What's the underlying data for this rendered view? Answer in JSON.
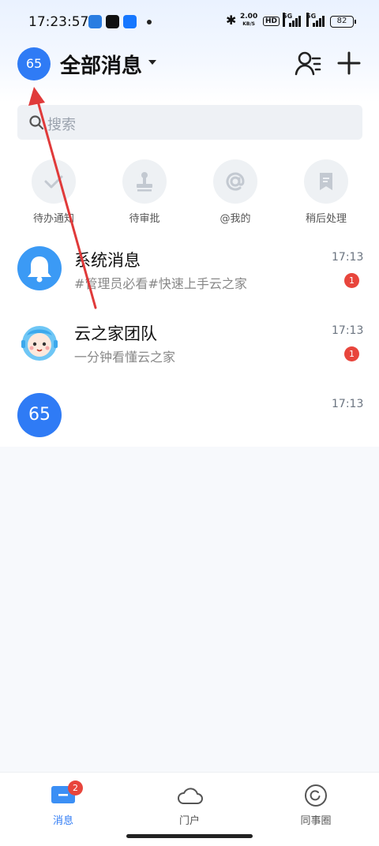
{
  "status_bar": {
    "time": "17:23:57",
    "net_speed_value": "2.00",
    "net_speed_unit": "KB/S",
    "hd_label": "HD",
    "signal_1_label": "5G",
    "signal_2_label": "5G",
    "battery": "82"
  },
  "header": {
    "avatar_text": "65",
    "title": "全部消息"
  },
  "search": {
    "placeholder": "搜索"
  },
  "quick_actions": [
    {
      "label": "待办通知",
      "icon": "check-icon"
    },
    {
      "label": "待审批",
      "icon": "stamp-icon"
    },
    {
      "label": "@我的",
      "icon": "at-icon"
    },
    {
      "label": "稍后处理",
      "icon": "bookmark-icon"
    }
  ],
  "conversations": [
    {
      "name": "系统消息",
      "preview": "#管理员必看#快速上手云之家",
      "time": "17:13",
      "unread": "1",
      "avatar": "bell-icon"
    },
    {
      "name": "云之家团队",
      "preview": "一分钟看懂云之家",
      "time": "17:13",
      "unread": "1",
      "avatar": "mascot-icon"
    },
    {
      "name": "",
      "preview": "",
      "time": "17:13",
      "unread": "",
      "avatar_text": "65"
    }
  ],
  "tabbar": {
    "tabs": [
      {
        "label": "消息",
        "active": true,
        "badge": "2",
        "icon": "message-icon"
      },
      {
        "label": "门户",
        "active": false,
        "icon": "cloud-icon"
      },
      {
        "label": "同事圈",
        "active": false,
        "icon": "circle-refresh-icon"
      }
    ]
  },
  "colors": {
    "accent": "#2f7bf5",
    "badge": "#e8453c",
    "annotation": "#e03a3a"
  }
}
